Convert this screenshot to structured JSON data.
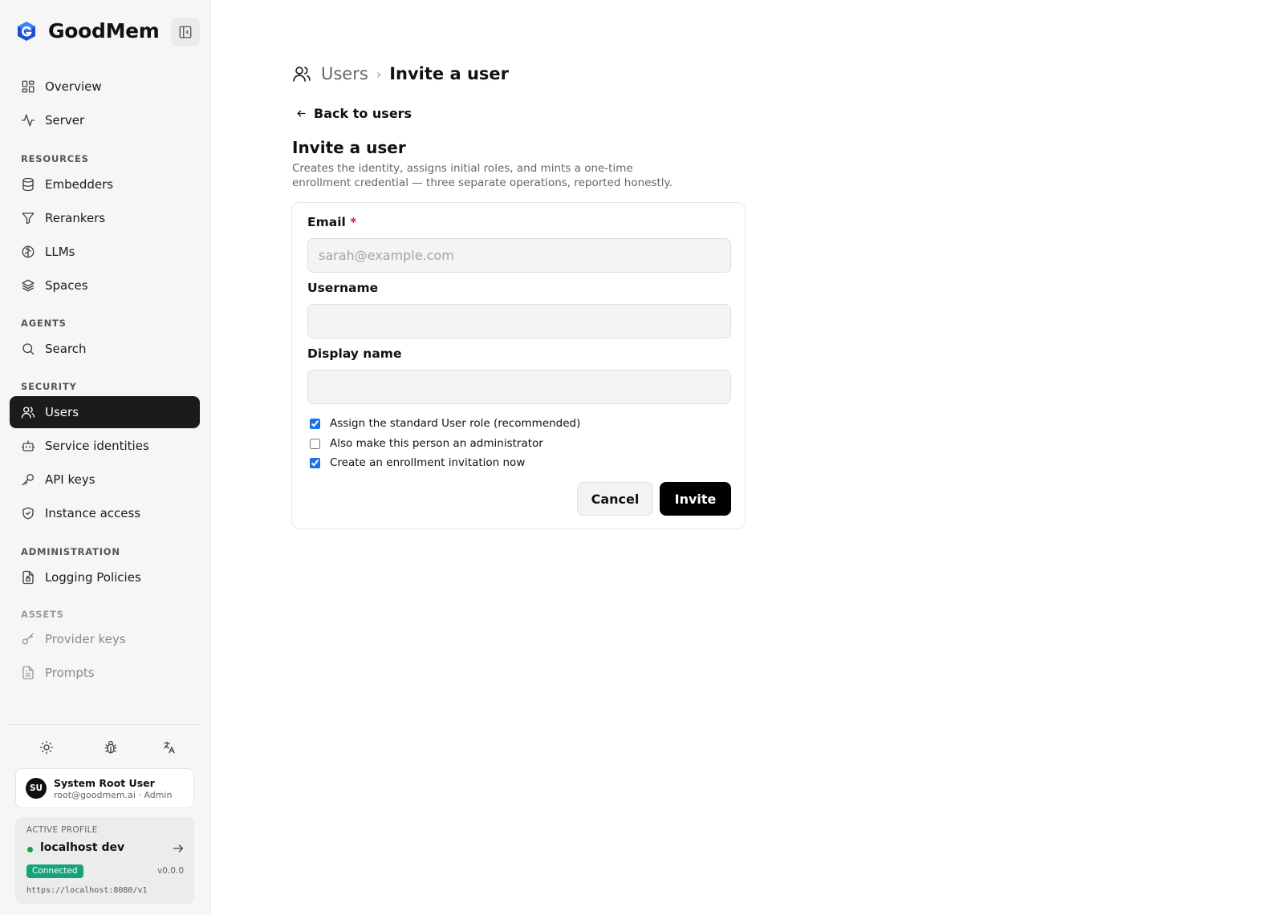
{
  "app": {
    "name": "GoodMem"
  },
  "sidebar": {
    "top_items": [
      {
        "label": "Overview",
        "icon": "grid-icon"
      },
      {
        "label": "Server",
        "icon": "activity-icon"
      }
    ],
    "sections": {
      "resources": {
        "label": "RESOURCES",
        "items": [
          {
            "label": "Embedders",
            "icon": "database-icon"
          },
          {
            "label": "Rerankers",
            "icon": "filter-icon"
          },
          {
            "label": "LLMs",
            "icon": "brain-icon"
          },
          {
            "label": "Spaces",
            "icon": "layers-icon"
          }
        ]
      },
      "agents": {
        "label": "AGENTS",
        "items": [
          {
            "label": "Search",
            "icon": "search-icon"
          }
        ]
      },
      "security": {
        "label": "SECURITY",
        "items": [
          {
            "label": "Users",
            "icon": "users-icon",
            "active": true
          },
          {
            "label": "Service identities",
            "icon": "bot-icon"
          },
          {
            "label": "API keys",
            "icon": "key-icon"
          },
          {
            "label": "Instance access",
            "icon": "shield-icon"
          }
        ]
      },
      "administration": {
        "label": "ADMINISTRATION",
        "items": [
          {
            "label": "Logging Policies",
            "icon": "file-lock-icon"
          }
        ]
      },
      "assets": {
        "label": "ASSETS",
        "items": [
          {
            "label": "Provider keys",
            "icon": "key-round-icon"
          },
          {
            "label": "Prompts",
            "icon": "file-text-icon"
          }
        ]
      }
    },
    "utility_icons": [
      "sun-icon",
      "bug-icon",
      "language-icon"
    ],
    "user": {
      "initials": "SU",
      "name": "System Root User",
      "subtitle": "root@goodmem.ai · Admin"
    },
    "profile": {
      "label": "ACTIVE PROFILE",
      "name": "localhost dev",
      "status": "Connected",
      "version": "v0.0.0",
      "url": "https://localhost:8080/v1",
      "status_color": "#16a37a"
    }
  },
  "breadcrumb": {
    "parent": "Users",
    "separator": "›",
    "current": "Invite a user"
  },
  "back_link": "Back to users",
  "page": {
    "title": "Invite a user",
    "description": "Creates the identity, assigns initial roles, and mints a one-time enrollment credential — three separate operations, reported honestly."
  },
  "form": {
    "email": {
      "label": "Email",
      "required_marker": "*",
      "value": "",
      "placeholder": "sarah@example.com"
    },
    "username": {
      "label": "Username",
      "value": "",
      "placeholder": ""
    },
    "display_name": {
      "label": "Display name",
      "value": "",
      "placeholder": ""
    },
    "checkboxes": [
      {
        "label": "Assign the standard User role (recommended)",
        "checked": true
      },
      {
        "label": "Also make this person an administrator",
        "checked": false
      },
      {
        "label": "Create an enrollment invitation now",
        "checked": true
      }
    ],
    "cancel_label": "Cancel",
    "submit_label": "Invite"
  },
  "colors": {
    "accent": "#000000",
    "active_nav_bg": "#1b1b1b",
    "required": "#e11d2e",
    "checkbox": "#1a73e8"
  }
}
